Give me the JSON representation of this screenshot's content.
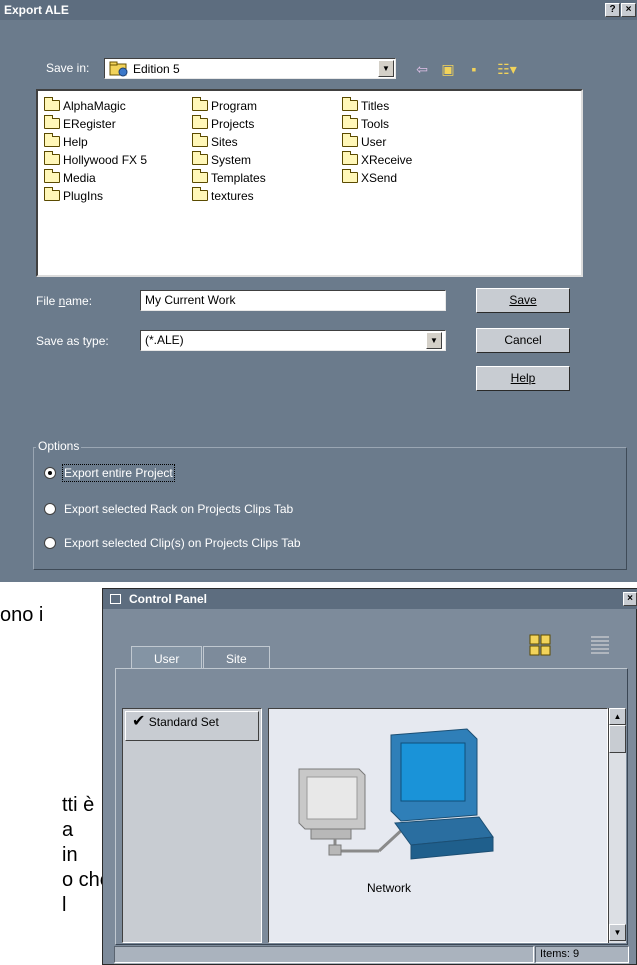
{
  "export_dialog": {
    "title": "Export ALE",
    "help_btn": "?",
    "close_btn": "×",
    "save_in_label": "Save in:",
    "save_in_value": "Edition 5",
    "folders": {
      "col1": [
        "AlphaMagic",
        "ERegister",
        "Help",
        "Hollywood FX 5",
        "Media",
        "PlugIns"
      ],
      "col2": [
        "Program",
        "Projects",
        "Sites",
        "System",
        "Templates",
        "textures"
      ],
      "col3": [
        "Titles",
        "Tools",
        "User",
        "XReceive",
        "XSend"
      ]
    },
    "file_name_label": "File name:",
    "file_name_value": "My Current Work",
    "save_as_type_label": "Save as type:",
    "save_as_type_value": "(*.ALE)",
    "buttons": {
      "save": "Save",
      "cancel": "Cancel",
      "help": "Help"
    },
    "options": {
      "title": "Options",
      "items": [
        {
          "label": "Export entire Project",
          "selected": true
        },
        {
          "label": "Export selected Rack on Projects Clips Tab",
          "selected": false
        },
        {
          "label": "Export selected Clip(s)  on Projects Clips Tab",
          "selected": false
        }
      ]
    }
  },
  "background_doc": {
    "lines": [
      "ono   i",
      "tti è",
      "a",
      "in",
      "o che",
      "l"
    ]
  },
  "control_panel": {
    "title": "Control Panel",
    "close_btn": "×",
    "tabs": [
      "User",
      "Site"
    ],
    "active_tab": "User",
    "sets": [
      "Standard Set"
    ],
    "selected_set": "Standard Set",
    "icon_label": "Network",
    "status": "Items: 9"
  },
  "colors": {
    "dialog_bg": "#6b7b8c",
    "title_bar": "#5d6d7f",
    "panel_bg": "#7d8b9b",
    "icon_area": "#e6e9f0"
  }
}
